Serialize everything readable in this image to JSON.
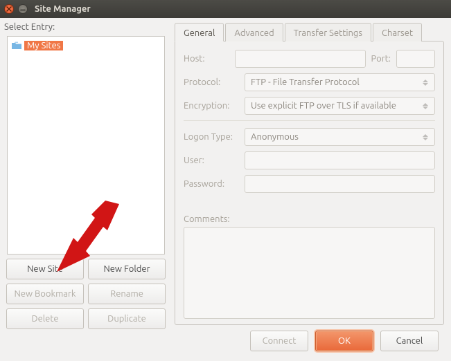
{
  "window": {
    "title": "Site Manager"
  },
  "left": {
    "select_entry_label": "Select Entry:",
    "tree_root_label": "My Sites",
    "buttons": {
      "new_site": "New Site",
      "new_folder": "New Folder",
      "new_bookmark": "New Bookmark",
      "rename": "Rename",
      "delete": "Delete",
      "duplicate": "Duplicate"
    }
  },
  "tabs": {
    "general": "General",
    "advanced": "Advanced",
    "transfer_settings": "Transfer Settings",
    "charset": "Charset"
  },
  "form": {
    "host_label": "Host:",
    "port_label": "Port:",
    "host_value": "",
    "port_value": "",
    "protocol_label": "Protocol:",
    "protocol_value": "FTP - File Transfer Protocol",
    "encryption_label": "Encryption:",
    "encryption_value": "Use explicit FTP over TLS if available",
    "logon_type_label": "Logon Type:",
    "logon_type_value": "Anonymous",
    "user_label": "User:",
    "user_value": "",
    "password_label": "Password:",
    "password_value": "",
    "comments_label": "Comments:",
    "comments_value": ""
  },
  "actions": {
    "connect": "Connect",
    "ok": "OK",
    "cancel": "Cancel"
  }
}
